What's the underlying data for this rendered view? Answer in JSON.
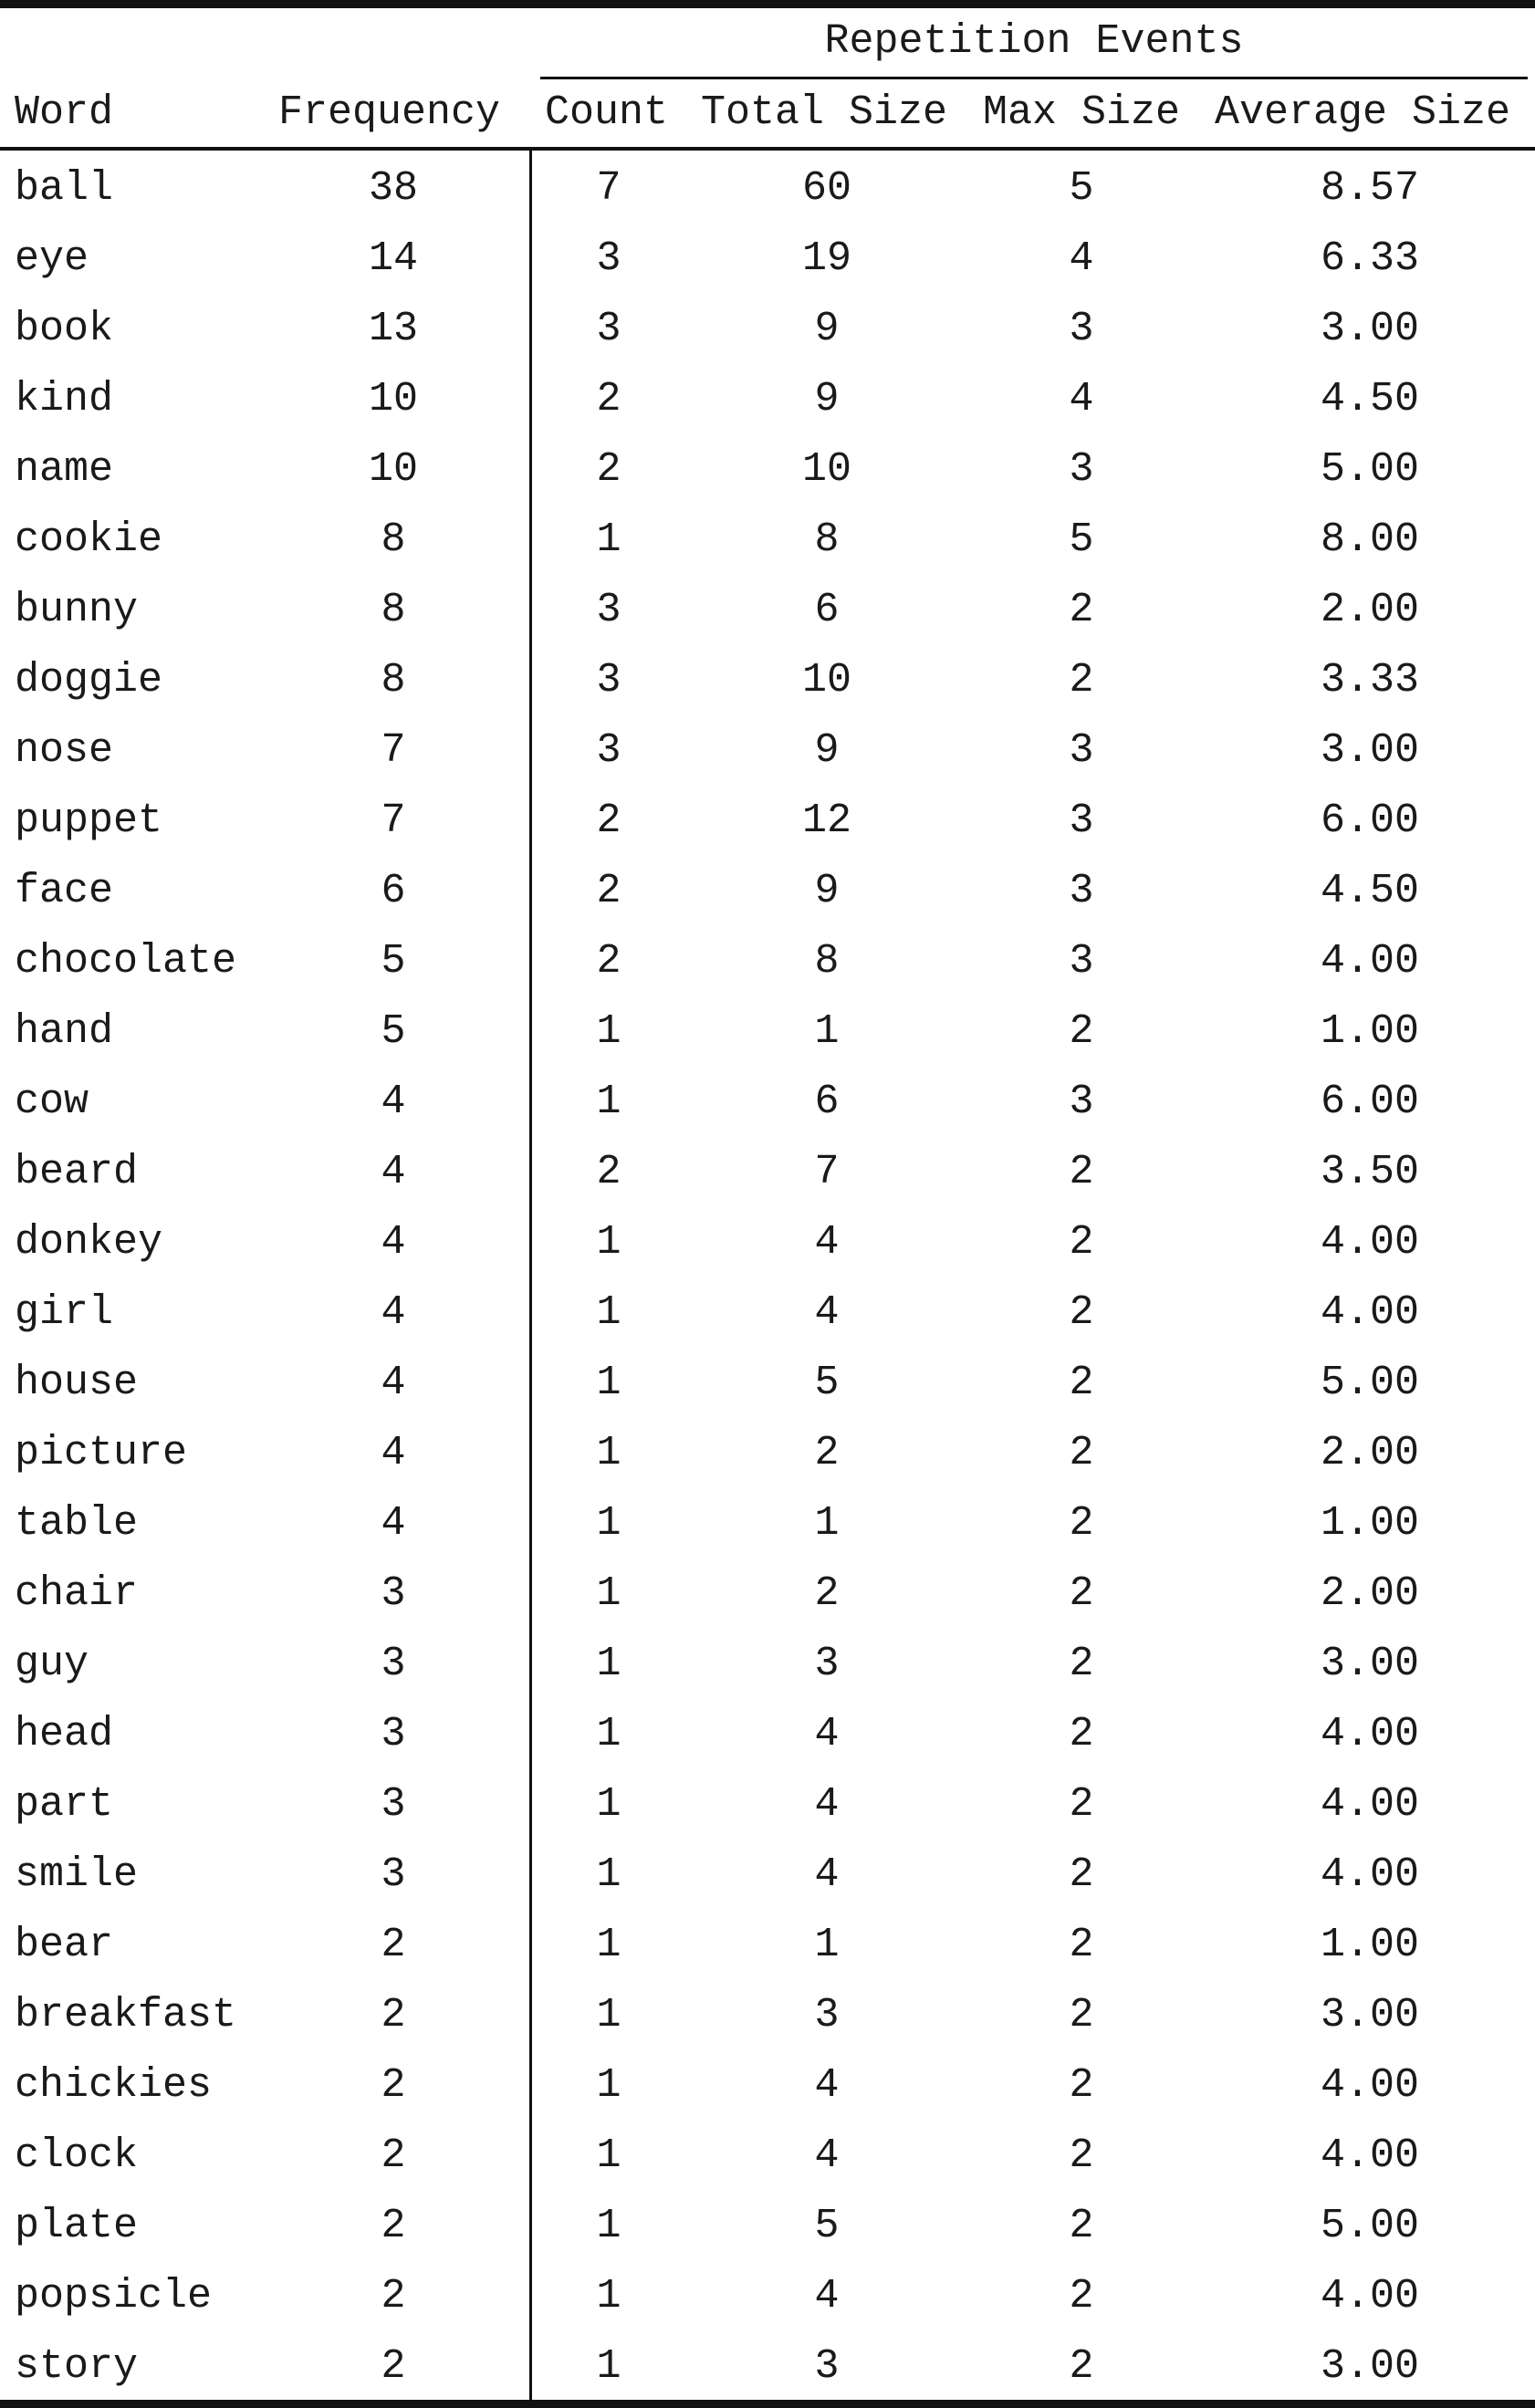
{
  "header": {
    "group_title": "Repetition Events",
    "columns": [
      "Word",
      "Frequency",
      "Count",
      "Total Size",
      "Max Size",
      "Average Size"
    ]
  },
  "rows": [
    [
      "ball",
      "38",
      "7",
      "60",
      "5",
      "8.57"
    ],
    [
      "eye",
      "14",
      "3",
      "19",
      "4",
      "6.33"
    ],
    [
      "book",
      "13",
      "3",
      "9",
      "3",
      "3.00"
    ],
    [
      "kind",
      "10",
      "2",
      "9",
      "4",
      "4.50"
    ],
    [
      "name",
      "10",
      "2",
      "10",
      "3",
      "5.00"
    ],
    [
      "cookie",
      "8",
      "1",
      "8",
      "5",
      "8.00"
    ],
    [
      "bunny",
      "8",
      "3",
      "6",
      "2",
      "2.00"
    ],
    [
      "doggie",
      "8",
      "3",
      "10",
      "2",
      "3.33"
    ],
    [
      "nose",
      "7",
      "3",
      "9",
      "3",
      "3.00"
    ],
    [
      "puppet",
      "7",
      "2",
      "12",
      "3",
      "6.00"
    ],
    [
      "face",
      "6",
      "2",
      "9",
      "3",
      "4.50"
    ],
    [
      "chocolate",
      "5",
      "2",
      "8",
      "3",
      "4.00"
    ],
    [
      "hand",
      "5",
      "1",
      "1",
      "2",
      "1.00"
    ],
    [
      "cow",
      "4",
      "1",
      "6",
      "3",
      "6.00"
    ],
    [
      "beard",
      "4",
      "2",
      "7",
      "2",
      "3.50"
    ],
    [
      "donkey",
      "4",
      "1",
      "4",
      "2",
      "4.00"
    ],
    [
      "girl",
      "4",
      "1",
      "4",
      "2",
      "4.00"
    ],
    [
      "house",
      "4",
      "1",
      "5",
      "2",
      "5.00"
    ],
    [
      "picture",
      "4",
      "1",
      "2",
      "2",
      "2.00"
    ],
    [
      "table",
      "4",
      "1",
      "1",
      "2",
      "1.00"
    ],
    [
      "chair",
      "3",
      "1",
      "2",
      "2",
      "2.00"
    ],
    [
      "guy",
      "3",
      "1",
      "3",
      "2",
      "3.00"
    ],
    [
      "head",
      "3",
      "1",
      "4",
      "2",
      "4.00"
    ],
    [
      "part",
      "3",
      "1",
      "4",
      "2",
      "4.00"
    ],
    [
      "smile",
      "3",
      "1",
      "4",
      "2",
      "4.00"
    ],
    [
      "bear",
      "2",
      "1",
      "1",
      "2",
      "1.00"
    ],
    [
      "breakfast",
      "2",
      "1",
      "3",
      "2",
      "3.00"
    ],
    [
      "chickies",
      "2",
      "1",
      "4",
      "2",
      "4.00"
    ],
    [
      "clock",
      "2",
      "1",
      "4",
      "2",
      "4.00"
    ],
    [
      "plate",
      "2",
      "1",
      "5",
      "2",
      "5.00"
    ],
    [
      "popsicle",
      "2",
      "1",
      "4",
      "2",
      "4.00"
    ],
    [
      "story",
      "2",
      "1",
      "3",
      "2",
      "3.00"
    ]
  ]
}
